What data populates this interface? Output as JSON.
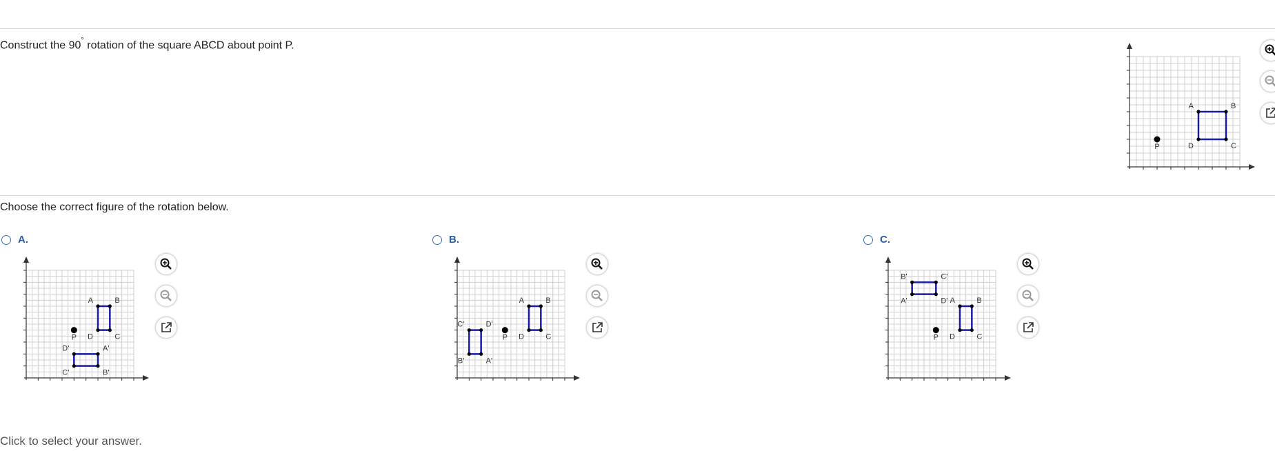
{
  "question": {
    "pre": "Construct the 90",
    "degree": "°",
    "post": " rotation of the square ABCD about point P."
  },
  "instruction": "Choose the correct figure of the rotation below.",
  "footer": "Click to select your answer.",
  "colors": {
    "square": "#1a1aa6",
    "grid": "#cfcfcf",
    "axis": "#333333",
    "option_label": "#2d5da0"
  },
  "icons": {
    "zoom_in": "zoom-in-icon",
    "zoom_out": "zoom-out-icon",
    "popout": "popout-icon"
  },
  "main_figure": {
    "point": {
      "label": "P",
      "x": 2,
      "y": 2
    },
    "square": [
      {
        "label": "A",
        "x": 5,
        "y": 4
      },
      {
        "label": "B",
        "x": 7,
        "y": 4
      },
      {
        "label": "C",
        "x": 7,
        "y": 2
      },
      {
        "label": "D",
        "x": 5,
        "y": 2
      }
    ]
  },
  "options": [
    {
      "label": "A.",
      "point": {
        "label": "P",
        "x": 4,
        "y": 4
      },
      "squares": [
        [
          {
            "label": "A",
            "x": 6,
            "y": 6
          },
          {
            "label": "B",
            "x": 7,
            "y": 6
          },
          {
            "label": "C",
            "x": 7,
            "y": 4
          },
          {
            "label": "D",
            "x": 6,
            "y": 4
          }
        ],
        [
          {
            "label": "D'",
            "x": 4,
            "y": 2
          },
          {
            "label": "A'",
            "x": 6,
            "y": 2
          },
          {
            "label": "B'",
            "x": 6,
            "y": 1
          },
          {
            "label": "C'",
            "x": 4,
            "y": 1
          }
        ]
      ]
    },
    {
      "label": "B.",
      "point": {
        "label": "P",
        "x": 4,
        "y": 4
      },
      "squares": [
        [
          {
            "label": "A",
            "x": 6,
            "y": 6
          },
          {
            "label": "B",
            "x": 7,
            "y": 6
          },
          {
            "label": "C",
            "x": 7,
            "y": 4
          },
          {
            "label": "D",
            "x": 6,
            "y": 4
          }
        ],
        [
          {
            "label": "C'",
            "x": 1,
            "y": 4
          },
          {
            "label": "D'",
            "x": 2,
            "y": 4
          },
          {
            "label": "A'",
            "x": 2,
            "y": 2
          },
          {
            "label": "B'",
            "x": 1,
            "y": 2
          }
        ]
      ]
    },
    {
      "label": "C.",
      "point": {
        "label": "P",
        "x": 4,
        "y": 4
      },
      "squares": [
        [
          {
            "label": "A",
            "x": 6,
            "y": 6
          },
          {
            "label": "B",
            "x": 7,
            "y": 6
          },
          {
            "label": "C",
            "x": 7,
            "y": 4
          },
          {
            "label": "D",
            "x": 6,
            "y": 4
          }
        ],
        [
          {
            "label": "B'",
            "x": 2,
            "y": 8
          },
          {
            "label": "C'",
            "x": 4,
            "y": 8
          },
          {
            "label": "D'",
            "x": 4,
            "y": 7
          },
          {
            "label": "A'",
            "x": 2,
            "y": 7
          }
        ]
      ]
    }
  ]
}
